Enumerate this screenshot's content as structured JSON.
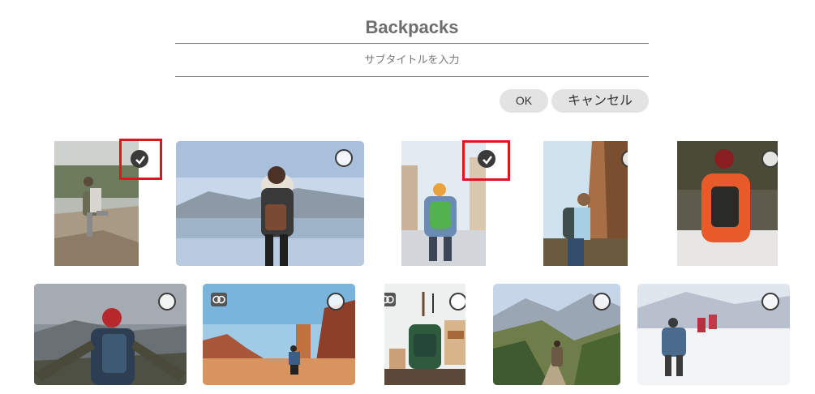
{
  "header": {
    "title": "Backpacks",
    "subtitle_placeholder": "サブタイトルを入力"
  },
  "buttons": {
    "ok_label": "OK",
    "cancel_label": "キャンセル"
  },
  "colors": {
    "highlight": "#e0141e",
    "button_bg": "#e3e3e3",
    "checked_circle": "#3a3a3a"
  },
  "photos": [
    {
      "subject": "hiker on cliff edge with backpack",
      "selected": true,
      "linked": false,
      "icon": "checked-circle-icon"
    },
    {
      "subject": "woman in fur hood coat by lake",
      "selected": false,
      "linked": false,
      "icon": "unchecked-circle-icon"
    },
    {
      "subject": "child with green backpack on snowy road",
      "selected": true,
      "linked": false,
      "icon": "checked-circle-icon"
    },
    {
      "subject": "man with backpack near rock cliff",
      "selected": false,
      "linked": false,
      "icon": "unchecked-circle-icon"
    },
    {
      "subject": "person in orange jacket sitting in snow",
      "selected": false,
      "linked": false,
      "icon": "unchecked-circle-icon"
    },
    {
      "subject": "hiker with red beanie on mountain top",
      "selected": false,
      "linked": false,
      "icon": "unchecked-circle-icon"
    },
    {
      "subject": "hiker in red rock canyon",
      "selected": false,
      "linked": true,
      "icon": "unchecked-circle-icon"
    },
    {
      "subject": "green backpack and hiking gear on wall",
      "selected": false,
      "linked": true,
      "icon": "unchecked-circle-icon"
    },
    {
      "subject": "hikers walking mountain valley trail",
      "selected": false,
      "linked": false,
      "icon": "unchecked-circle-icon"
    },
    {
      "subject": "group hiking on snowy slope",
      "selected": false,
      "linked": false,
      "icon": "unchecked-circle-icon"
    }
  ]
}
